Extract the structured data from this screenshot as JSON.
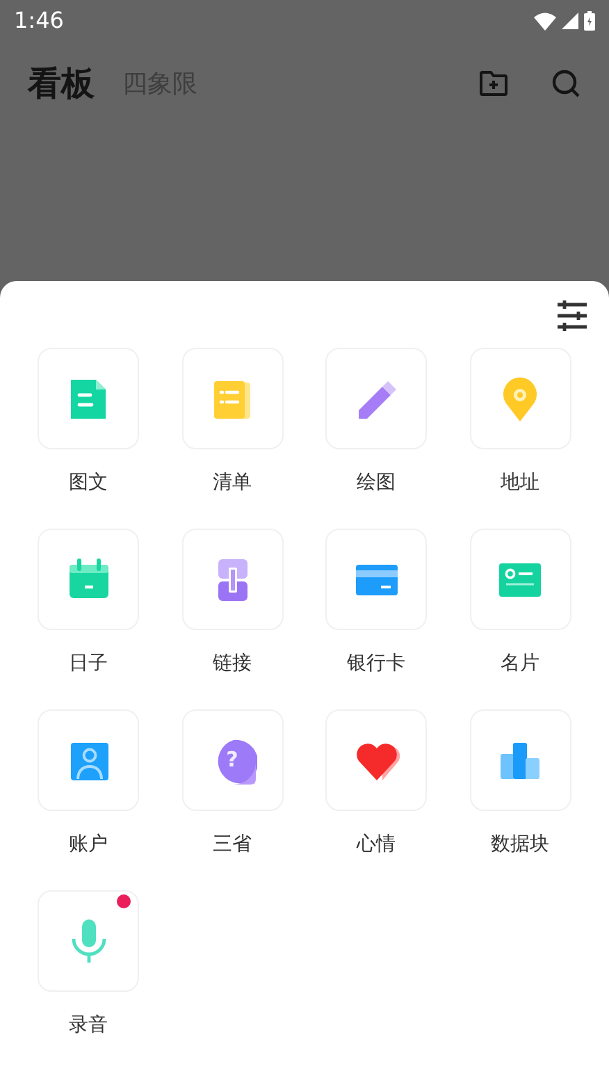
{
  "status_bar": {
    "time": "1:46"
  },
  "header": {
    "title": "看板",
    "subtitle": "四象限"
  },
  "items": [
    {
      "kind": "doc",
      "label": "图文",
      "dot": false
    },
    {
      "kind": "list",
      "label": "清单",
      "dot": false
    },
    {
      "kind": "pencil",
      "label": "绘图",
      "dot": false
    },
    {
      "kind": "pin",
      "label": "地址",
      "dot": false
    },
    {
      "kind": "calendar",
      "label": "日子",
      "dot": false
    },
    {
      "kind": "link",
      "label": "链接",
      "dot": false
    },
    {
      "kind": "card",
      "label": "银行卡",
      "dot": false
    },
    {
      "kind": "idcard",
      "label": "名片",
      "dot": false
    },
    {
      "kind": "account",
      "label": "账户",
      "dot": false
    },
    {
      "kind": "question",
      "label": "三省",
      "glyph": "?",
      "dot": false
    },
    {
      "kind": "heart",
      "label": "心情",
      "dot": false
    },
    {
      "kind": "bars",
      "label": "数据块",
      "dot": false
    },
    {
      "kind": "mic",
      "label": "录音",
      "dot": true
    }
  ]
}
